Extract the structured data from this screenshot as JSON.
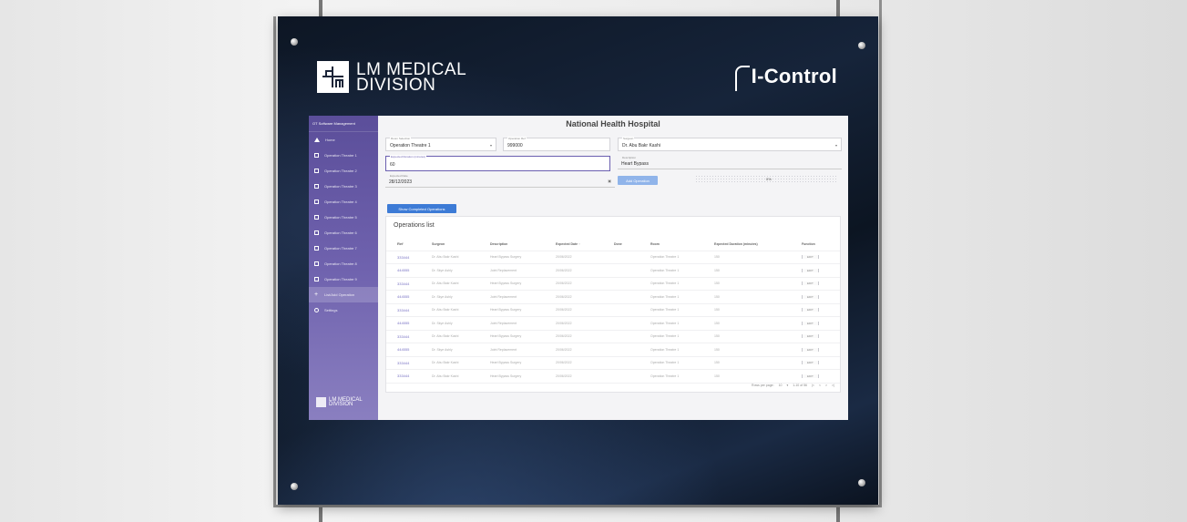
{
  "brand": {
    "left_logo_line1": "LM MEDICAL",
    "left_logo_line2": "DIVISION",
    "right_logo": "I-Control"
  },
  "sidebar": {
    "header": "OT Software Management",
    "items": [
      {
        "label": "Home",
        "icon": "home-icon"
      },
      {
        "label": "Operation Theatre 1",
        "icon": "calendar-icon"
      },
      {
        "label": "Operation Theatre 2",
        "icon": "calendar-icon"
      },
      {
        "label": "Operation Theatre 3",
        "icon": "calendar-icon"
      },
      {
        "label": "Operation Theatre 4",
        "icon": "calendar-icon"
      },
      {
        "label": "Operation Theatre 5",
        "icon": "calendar-icon"
      },
      {
        "label": "Operation Theatre 6",
        "icon": "calendar-icon"
      },
      {
        "label": "Operation Theatre 7",
        "icon": "calendar-icon"
      },
      {
        "label": "Operation Theatre 8",
        "icon": "calendar-icon"
      },
      {
        "label": "Operation Theatre 9",
        "icon": "calendar-icon"
      },
      {
        "label": "List/Add Operation",
        "icon": "plus-icon"
      },
      {
        "label": "Settings",
        "icon": "gear-icon"
      }
    ],
    "logo_line1": "LM MEDICAL",
    "logo_line2": "DIVISION"
  },
  "main": {
    "title": "National Health Hospital",
    "form": {
      "room_label": "Room Selection",
      "room_value": "Operation Theatre 1",
      "op_ref_label": "Operation Ref",
      "op_ref_value": "999000",
      "surgeon_label": "Surgeon",
      "surgeon_value": "Dr. Abu Bakr Kashi",
      "duration_label": "Expected Duration (minutes)",
      "duration_value": "60",
      "description_label": "Description",
      "description_value": "Heart Bypass",
      "date_label": "Expected Date",
      "date_value": "28/12/2023",
      "add_button": "Add Operation",
      "progress_text": "0%"
    },
    "show_completed_button": "Show Completed Operations",
    "list_title": "Operations list",
    "columns": [
      "Ref",
      "Surgeon",
      "Description",
      "Expected Date ↑",
      "Done",
      "Room",
      "Expected Duration (minutes)",
      "Function"
    ],
    "rows": [
      {
        "ref": "333444",
        "surgeon": "Dr. Abu Bakr Kashi",
        "desc": "Heart Bypass Surgery",
        "date": "20/06/2022",
        "done": "",
        "room": "Operation Theatre 1",
        "dur": "150",
        "fn": "EDIT"
      },
      {
        "ref": "444555",
        "surgeon": "Dr. Skye Ashly",
        "desc": "Joint Replacement",
        "date": "20/06/2022",
        "done": "",
        "room": "Operation Theatre 1",
        "dur": "150",
        "fn": "EDIT"
      },
      {
        "ref": "333444",
        "surgeon": "Dr. Abu Bakr Kashi",
        "desc": "Heart Bypass Surgery",
        "date": "20/06/2022",
        "done": "",
        "room": "Operation Theatre 1",
        "dur": "150",
        "fn": "EDIT"
      },
      {
        "ref": "444555",
        "surgeon": "Dr. Skye Ashly",
        "desc": "Joint Replacement",
        "date": "20/06/2022",
        "done": "",
        "room": "Operation Theatre 1",
        "dur": "150",
        "fn": "EDIT"
      },
      {
        "ref": "333444",
        "surgeon": "Dr. Abu Bakr Kashi",
        "desc": "Heart Bypass Surgery",
        "date": "20/06/2022",
        "done": "",
        "room": "Operation Theatre 1",
        "dur": "150",
        "fn": "EDIT"
      },
      {
        "ref": "444555",
        "surgeon": "Dr. Skye Ashly",
        "desc": "Joint Replacement",
        "date": "20/06/2022",
        "done": "",
        "room": "Operation Theatre 1",
        "dur": "150",
        "fn": "EDIT"
      },
      {
        "ref": "333444",
        "surgeon": "Dr. Abu Bakr Kashi",
        "desc": "Heart Bypass Surgery",
        "date": "20/06/2022",
        "done": "",
        "room": "Operation Theatre 1",
        "dur": "150",
        "fn": "EDIT"
      },
      {
        "ref": "444555",
        "surgeon": "Dr. Skye Ashly",
        "desc": "Joint Replacement",
        "date": "20/06/2022",
        "done": "",
        "room": "Operation Theatre 1",
        "dur": "150",
        "fn": "EDIT"
      },
      {
        "ref": "333444",
        "surgeon": "Dr. Abu Bakr Kashi",
        "desc": "Heart Bypass Surgery",
        "date": "20/06/2022",
        "done": "",
        "room": "Operation Theatre 1",
        "dur": "150",
        "fn": "EDIT"
      },
      {
        "ref": "333444",
        "surgeon": "Dr. Abu Bakr Kashi",
        "desc": "Heart Bypass Surgery",
        "date": "20/06/2022",
        "done": "",
        "room": "Operation Theatre 1",
        "dur": "150",
        "fn": "EDIT"
      }
    ],
    "pager": {
      "rows_label": "Rows per page:",
      "rows_value": "10",
      "range": "1-10 of 56",
      "first": "|<",
      "prev": "<",
      "next": ">",
      "last": ">|"
    }
  },
  "colors": {
    "sidebar_top": "#5b4e9a",
    "accent": "#3d7bd6",
    "ref_link": "#7a73c4"
  }
}
